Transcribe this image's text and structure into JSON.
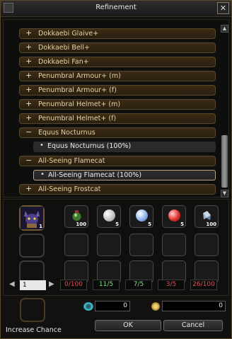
{
  "window": {
    "title": "Refinement",
    "close_label": "✕"
  },
  "list": {
    "rows": [
      {
        "sign": "+",
        "label": "Dokkaebi Glaive+"
      },
      {
        "sign": "+",
        "label": "Dokkaebi Bell+"
      },
      {
        "sign": "+",
        "label": "Dokkaebi Fan+"
      },
      {
        "sign": "+",
        "label": "Penumbral Armour+ (m)"
      },
      {
        "sign": "+",
        "label": "Penumbral Armour+ (f)"
      },
      {
        "sign": "+",
        "label": "Penumbral Helmet+ (m)"
      },
      {
        "sign": "+",
        "label": "Penumbral Helmet+ (f)"
      },
      {
        "sign": "−",
        "label": "Equus Nocturnus"
      },
      {
        "sign": "•",
        "label": "Equus Nocturnus (100%)"
      },
      {
        "sign": "−",
        "label": "All-Seeing Flamecat"
      },
      {
        "sign": "•",
        "label": "All-Seeing Flamecat (100%)"
      },
      {
        "sign": "+",
        "label": "All-Seeing Frostcat"
      }
    ],
    "scroll_up": "▲",
    "scroll_down": "▼"
  },
  "materials": {
    "target_count": "1",
    "items": [
      {
        "count": "100",
        "color": "#3e7a2c"
      },
      {
        "count": "5",
        "color": "#dedede"
      },
      {
        "count": "5",
        "color": "#8fb4ea"
      },
      {
        "count": "5",
        "color": "#e0302c"
      },
      {
        "count": "100",
        "color": "#c8d8e8"
      }
    ],
    "counters": [
      {
        "text": "0/100",
        "color": "#e05050"
      },
      {
        "text": "11/5",
        "color": "#80e080"
      },
      {
        "text": "7/5",
        "color": "#80e080"
      },
      {
        "text": "3/5",
        "color": "#e05050"
      },
      {
        "text": "26/100",
        "color": "#e05050"
      }
    ],
    "page": "1",
    "prev": "◀",
    "next": "▶"
  },
  "bottom": {
    "increase_chance_label": "Increase Chance",
    "value1": "0",
    "value2": "0",
    "ok_label": "OK",
    "cancel_label": "Cancel"
  }
}
